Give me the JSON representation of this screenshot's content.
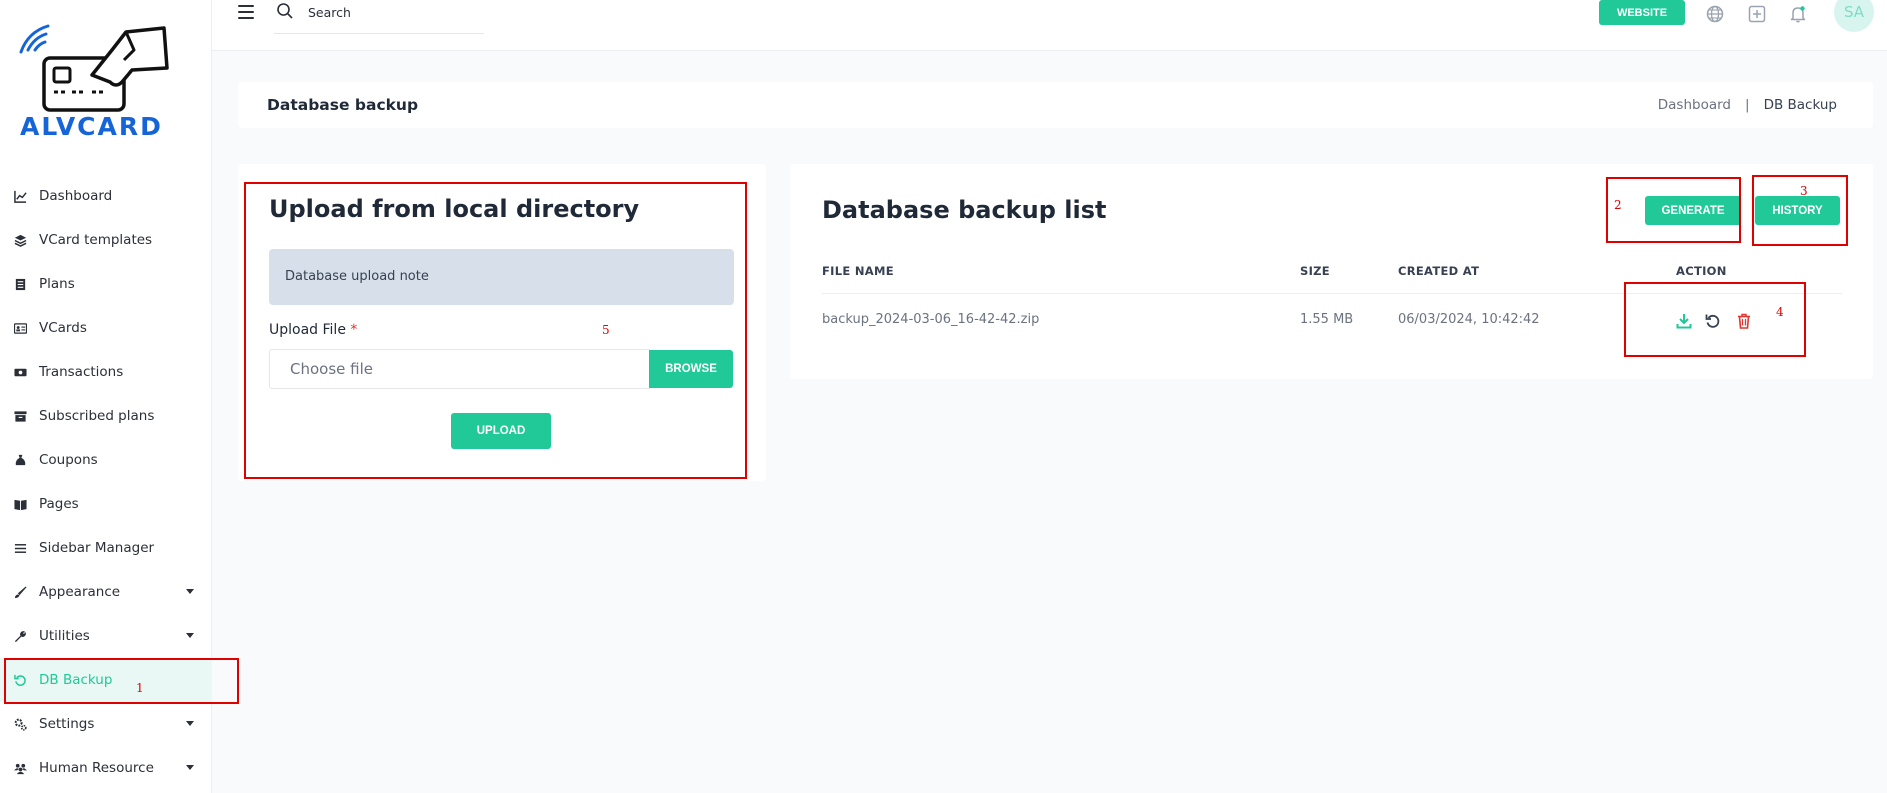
{
  "brand": {
    "name": "ALVCARD"
  },
  "sidebar": {
    "items": [
      {
        "label": "Dashboard",
        "icon": "chart-line-icon"
      },
      {
        "label": "VCard templates",
        "icon": "layers-icon"
      },
      {
        "label": "Plans",
        "icon": "list-doc-icon"
      },
      {
        "label": "VCards",
        "icon": "id-card-icon"
      },
      {
        "label": "Transactions",
        "icon": "money-icon"
      },
      {
        "label": "Subscribed plans",
        "icon": "archive-icon"
      },
      {
        "label": "Coupons",
        "icon": "money-bag-icon"
      },
      {
        "label": "Pages",
        "icon": "book-icon"
      },
      {
        "label": "Sidebar Manager",
        "icon": "bars-icon"
      },
      {
        "label": "Appearance",
        "icon": "brush-icon"
      },
      {
        "label": "Utilities",
        "icon": "wrench-icon"
      },
      {
        "label": "DB Backup",
        "icon": "restore-icon"
      },
      {
        "label": "Settings",
        "icon": "cogs-icon"
      },
      {
        "label": "Human Resource",
        "icon": "users-icon"
      }
    ]
  },
  "topbar": {
    "search_placeholder": "Search",
    "website_label": "WEBSITE",
    "avatar_initials": "SA"
  },
  "page": {
    "title": "Database backup",
    "breadcrumb": {
      "home": "Dashboard",
      "separator": "|",
      "current": "DB Backup"
    }
  },
  "upload": {
    "heading": "Upload from local directory",
    "note": "Database upload note",
    "file_label": "Upload File",
    "required_mark": "*",
    "file_placeholder": "Choose file",
    "browse_label": "BROWSE",
    "upload_label": "UPLOAD"
  },
  "backup_list": {
    "heading": "Database backup list",
    "generate_label": "GENERATE",
    "history_label": "HISTORY",
    "columns": [
      "FILE NAME",
      "SIZE",
      "CREATED AT",
      "ACTION"
    ],
    "rows": [
      {
        "file_name": "backup_2024-03-06_16-42-42.zip",
        "size": "1.55 MB",
        "created_at": "06/03/2024, 10:42:42"
      }
    ]
  },
  "annotations": [
    "1",
    "2",
    "3",
    "4",
    "5"
  ],
  "colors": {
    "accent": "#20c997",
    "brand": "#1565d8",
    "annotation": "#e00000",
    "danger": "#e3342f"
  }
}
